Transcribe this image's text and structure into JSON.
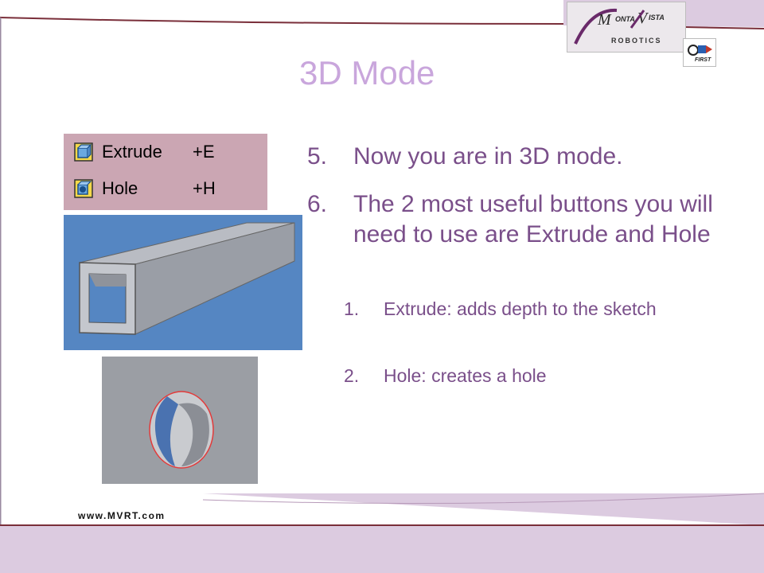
{
  "slide": {
    "title": "3D Mode",
    "logo_text": "ROBOTICS",
    "logo_mark": "MONTA VISTA",
    "first_label": "FIRST",
    "footer_url": "www.MVRT.com"
  },
  "toolbar": {
    "items": [
      {
        "label": "Extrude",
        "shortcut": "+E",
        "icon": "extrude-icon"
      },
      {
        "label": "Hole",
        "shortcut": "+H",
        "icon": "hole-icon"
      }
    ]
  },
  "bullets": [
    {
      "num": "5.",
      "text": "Now you are in 3D mode."
    },
    {
      "num": "6.",
      "text": "The 2 most useful buttons you will need to use are Extrude and Hole"
    }
  ],
  "sub_bullets": [
    {
      "num": "1.",
      "text": "Extrude: adds depth to the sketch"
    },
    {
      "num": "2.",
      "text": "Hole: creates a hole"
    }
  ],
  "colors": {
    "title": "#c9a6dc",
    "bullet_text": "#7a4f8a",
    "frame": "#7a2f3a",
    "band": "#d9c6dc",
    "toolbar_bg": "#cba6b3",
    "tube_bg": "#5586c2"
  }
}
